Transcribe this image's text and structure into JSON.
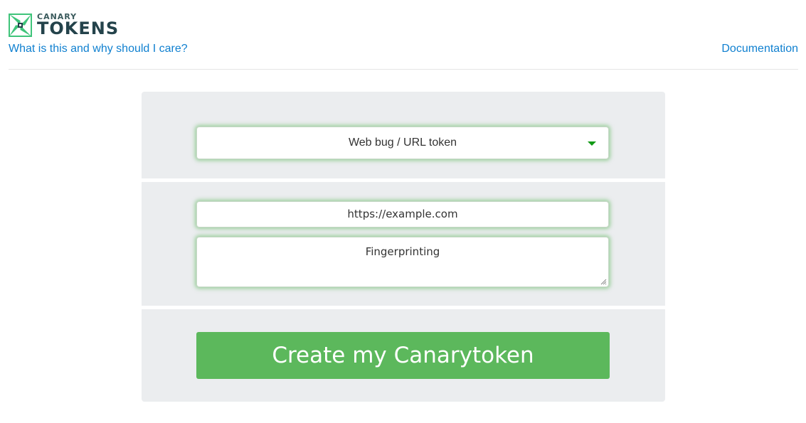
{
  "logo": {
    "top_text": "CANARY",
    "bottom_text": "TOKENS",
    "icon": "canary-square-logo-icon",
    "colors": {
      "green": "#3fc47a",
      "dark": "#24434b"
    }
  },
  "header": {
    "about_link": "What is this and why should I care?",
    "docs_link": "Documentation",
    "link_color": "#1080d0"
  },
  "form": {
    "token_type": {
      "selected": "Web bug / URL token",
      "caret_icon": "caret-down-icon",
      "caret_color": "#119a15"
    },
    "email": {
      "value": "https://example.com"
    },
    "memo": {
      "value": "Fingerprinting"
    },
    "submit": {
      "label": "Create my Canarytoken",
      "color": "#5cb85c"
    }
  }
}
